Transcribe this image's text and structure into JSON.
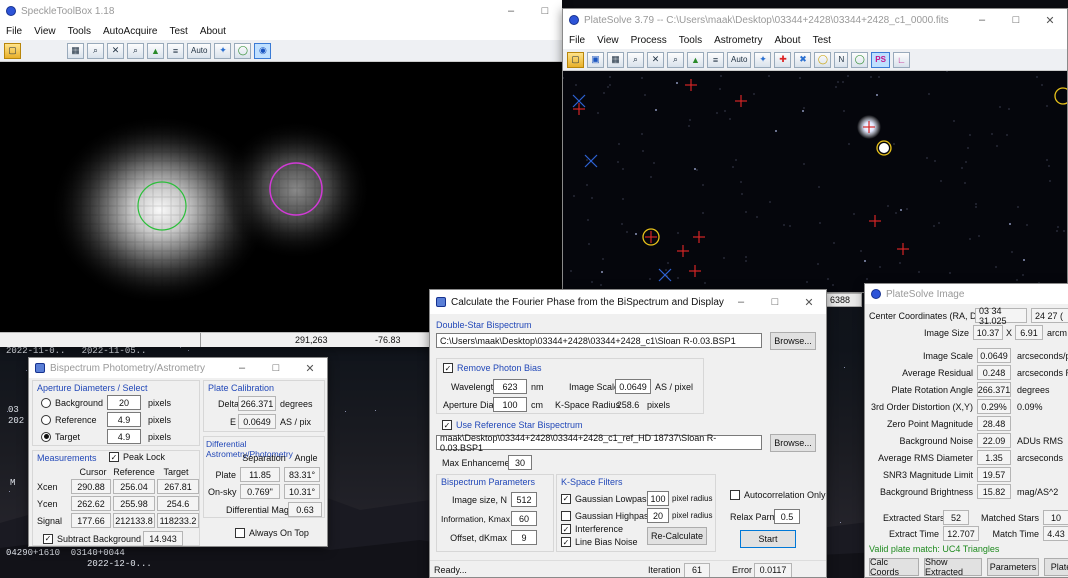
{
  "speckle": {
    "title": "SpeckleToolBox 1.18",
    "menu": [
      "File",
      "View",
      "Tools",
      "AutoAcquire",
      "Test",
      "About"
    ],
    "toolbar_auto": "Auto",
    "status": {
      "x": "291,263",
      "y": "-76.83"
    }
  },
  "platesolve": {
    "title": "PlateSolve 3.79 -- C:\\Users\\maak\\Desktop\\03344+2428\\03344+2428_c1_0000.fits",
    "menu": [
      "File",
      "View",
      "Process",
      "Tools",
      "Astrometry",
      "About",
      "Test"
    ],
    "toolbar_auto": "Auto",
    "toolbar_n": "N",
    "toolbar_ps": "PS",
    "partial_readout": "6388"
  },
  "desktop": {
    "dates": "2022-11-0..   2022-11-05..",
    "left_clip1": "03",
    "left_clip2": "202",
    "left_clip3": "M",
    "bottom_text": "04290+1610  03140+0044\n               2022-12-0..."
  },
  "bispec_phot": {
    "title": "Bispectrum Photometry/Astrometry",
    "aperture": {
      "title": "Aperture Diameters / Select",
      "rows": [
        {
          "label": "Background",
          "value": "20",
          "unit": "pixels",
          "selected": false
        },
        {
          "label": "Reference",
          "value": "4.9",
          "unit": "pixels",
          "selected": false
        },
        {
          "label": "Target",
          "value": "4.9",
          "unit": "pixels",
          "selected": true
        }
      ]
    },
    "plate_cal": {
      "title": "Plate Calibration",
      "delta_label": "Delta",
      "delta_value": "266.371",
      "delta_unit": "degrees",
      "e_label": "E",
      "e_value": "0.0649",
      "e_unit": "AS / pix"
    },
    "measurements": {
      "title": "Measurements",
      "peak_lock": "Peak Lock",
      "headers": [
        "Cursor",
        "Reference",
        "Target"
      ],
      "rows": [
        {
          "label": "Xcen",
          "values": [
            "290.88",
            "256.04",
            "267.81"
          ]
        },
        {
          "label": "Ycen",
          "values": [
            "262.62",
            "255.98",
            "254.6"
          ]
        },
        {
          "label": "Signal",
          "values": [
            "177.66",
            "212133.8",
            "118233.2"
          ]
        }
      ],
      "subtract_bg": "Subtract Background",
      "subtract_value": "14.943"
    },
    "diff": {
      "title": "Differential Astrometry/Photometry",
      "headers": [
        "Separation",
        "Angle"
      ],
      "plate_label": "Plate",
      "plate_sep": "11.85",
      "plate_angle": "83.31°",
      "onsky_label": "On-sky",
      "onsky_sep": "0.769\"",
      "onsky_angle": "10.31°",
      "mag_label": "Differential Mag",
      "mag_value": "0.63"
    },
    "always_on_top": "Always On Top"
  },
  "fourier": {
    "title": "Calculate the Fourier Phase from the BiSpectrum and Display",
    "double_star_title": "Double-Star Bispectrum",
    "double_star_path": "C:\\Users\\maak\\Desktop\\03344+2428\\03344+2428_c1\\Sloan R-0.03.BSP1",
    "browse": "Browse...",
    "remove_bias": "Remove Photon Bias",
    "wavelength_label": "Wavelength",
    "wavelength_value": "623",
    "wavelength_unit": "nm",
    "image_scale_label": "Image Scale",
    "image_scale_value": "0.0649",
    "image_scale_unit": "AS / pixel",
    "aperture_label": "Aperture Diam",
    "aperture_value": "100",
    "aperture_unit": "cm",
    "kspace_label": "K-Space Radius",
    "kspace_value": "258.6",
    "kspace_unit": "pixels",
    "use_ref": "Use Reference Star Bispectrum",
    "ref_path": "maak\\Desktop\\03344+2428\\03344+2428_c1_ref_HD 18737\\Sloan R-0.03.BSP1",
    "max_enh_label": "Max Enhancement",
    "max_enh_value": "30",
    "bispec_params_title": "Bispectrum Parameters",
    "image_size_label": "Image size, N",
    "image_size_value": "512",
    "info_label": "Information, Kmax",
    "info_value": "60",
    "offset_label": "Offset, dKmax",
    "offset_value": "9",
    "kspace_filters_title": "K-Space Filters",
    "gauss_low": "Gaussian Lowpass",
    "gauss_low_value": "100",
    "gauss_high": "Gaussian Highpass",
    "gauss_high_value": "20",
    "pixel_radius": "pixel radius",
    "interference": "Interference",
    "line_bias": "Line Bias Noise",
    "recalc": "Re-Calculate",
    "autocorr": "Autocorrelation Only",
    "relax_label": "Relax Parm",
    "relax_value": "0.5",
    "start": "Start",
    "status_ready": "Ready...",
    "iteration_label": "Iteration",
    "iteration_value": "61",
    "error_label": "Error",
    "error_value": "0.0117"
  },
  "psimage": {
    "title": "PlateSolve Image",
    "center_label": "Center Coordinates (RA, Dec)",
    "center_ra": "03 34 31.025",
    "center_dec": "24 27 (",
    "size_label": "Image Size",
    "size_w": "10.37",
    "size_x": "X",
    "size_h": "6.91",
    "size_unit": "arcm",
    "rows": [
      {
        "label": "Image Scale",
        "value": "0.0649",
        "extra": "arcseconds/pix"
      },
      {
        "label": "Average Residual",
        "value": "0.248",
        "extra": "arcseconds RM"
      },
      {
        "label": "Plate Rotation Angle",
        "value": "266.371",
        "extra": "degrees"
      },
      {
        "label": "3rd Order Distortion (X,Y)",
        "value": "0.29%",
        "extra": "0.09%"
      },
      {
        "label": "Zero Point Magnitude",
        "value": "28.48",
        "extra": ""
      },
      {
        "label": "Background Noise",
        "value": "22.09",
        "extra": "ADUs RMS"
      },
      {
        "label": "Average RMS Diameter",
        "value": "1.35",
        "extra": "arcseconds"
      },
      {
        "label": "SNR3 Magnitude Limit",
        "value": "19.57",
        "extra": ""
      },
      {
        "label": "Background Brightness",
        "value": "15.82",
        "extra": "mag/AS^2"
      }
    ],
    "extracted_label": "Extracted Stars",
    "extracted_value": "52",
    "matched_label": "Matched Stars",
    "matched_value": "10",
    "extract_time_label": "Extract Time",
    "extract_time_value": "12.707",
    "match_time_label": "Match Time",
    "match_time_value": "4.43",
    "valid_match": "Valid plate match: UC4 Triangles",
    "buttons": [
      "Calc Coords",
      "Show Extracted",
      "Parameters",
      "Plate"
    ]
  }
}
